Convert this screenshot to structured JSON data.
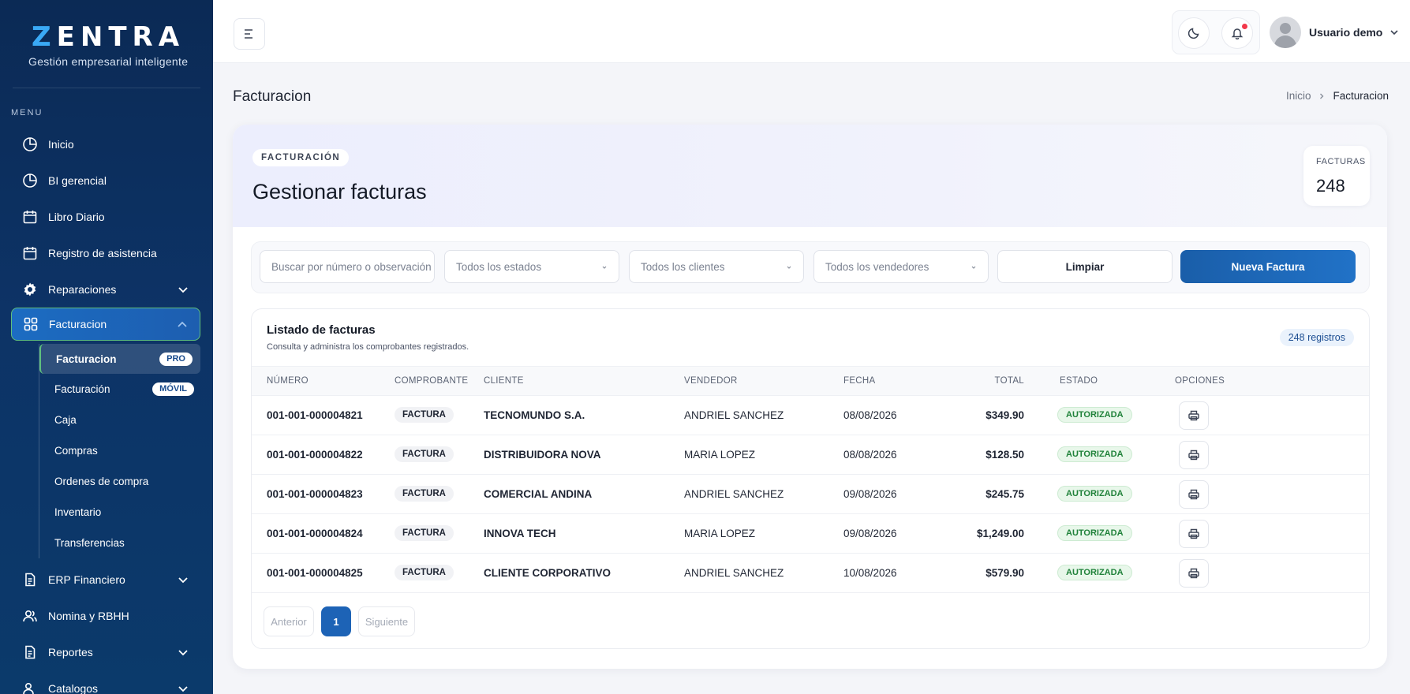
{
  "brand": {
    "logo_z": "Z",
    "logo_rest": "ENTRA",
    "tagline": "Gestión empresarial inteligente"
  },
  "sidebar": {
    "menu_title": "MENU",
    "items": [
      {
        "label": "Inicio",
        "icon": "pie-chart-icon"
      },
      {
        "label": "BI gerencial",
        "icon": "pie-chart-icon"
      },
      {
        "label": "Libro Diario",
        "icon": "calendar-icon"
      },
      {
        "label": "Registro de asistencia",
        "icon": "calendar-icon"
      },
      {
        "label": "Reparaciones",
        "icon": "gear-icon"
      },
      {
        "label": "Facturacion",
        "icon": "grid-icon"
      },
      {
        "label": "ERP Financiero",
        "icon": "document-icon"
      },
      {
        "label": "Nomina y RBHH",
        "icon": "users-icon"
      },
      {
        "label": "Reportes",
        "icon": "document-icon"
      },
      {
        "label": "Catalogos",
        "icon": "users-icon"
      }
    ],
    "submenu": [
      {
        "label": "Facturacion",
        "badge": "PRO"
      },
      {
        "label": "Facturación",
        "badge": "MÓVIL"
      },
      {
        "label": "Caja"
      },
      {
        "label": "Compras"
      },
      {
        "label": "Ordenes de compra"
      },
      {
        "label": "Inventario"
      },
      {
        "label": "Transferencias"
      }
    ]
  },
  "topbar": {
    "user_name": "Usuario demo"
  },
  "page": {
    "title": "Facturacion",
    "breadcrumb": {
      "home": "Inicio",
      "current": "Facturacion"
    }
  },
  "hero": {
    "tag": "FACTURACIÓN",
    "title": "Gestionar facturas",
    "stat_label": "FACTURAS",
    "stat_value": "248"
  },
  "filters": {
    "search_placeholder": "Buscar por número o observación",
    "estado": "Todos los estados",
    "cliente": "Todos los clientes",
    "vendedor": "Todos los vendedores",
    "clear_label": "Limpiar",
    "new_label": "Nueva Factura"
  },
  "list": {
    "title": "Listado de facturas",
    "subtitle": "Consulta y administra los comprobantes registrados.",
    "count": "248 registros",
    "columns": [
      "NÚMERO",
      "COMPROBANTE",
      "CLIENTE",
      "VENDEDOR",
      "FECHA",
      "TOTAL",
      "ESTADO",
      "OPCIONES"
    ],
    "rows": [
      {
        "numero": "001-001-000004821",
        "comprobante": "FACTURA",
        "cliente": "TECNOMUNDO S.A.",
        "vendedor": "ANDRIEL SANCHEZ",
        "fecha": "08/08/2026",
        "total": "$349.90",
        "estado": "AUTORIZADA"
      },
      {
        "numero": "001-001-000004822",
        "comprobante": "FACTURA",
        "cliente": "DISTRIBUIDORA NOVA",
        "vendedor": "MARIA LOPEZ",
        "fecha": "08/08/2026",
        "total": "$128.50",
        "estado": "AUTORIZADA"
      },
      {
        "numero": "001-001-000004823",
        "comprobante": "FACTURA",
        "cliente": "COMERCIAL ANDINA",
        "vendedor": "ANDRIEL SANCHEZ",
        "fecha": "09/08/2026",
        "total": "$245.75",
        "estado": "AUTORIZADA"
      },
      {
        "numero": "001-001-000004824",
        "comprobante": "FACTURA",
        "cliente": "INNOVA TECH",
        "vendedor": "MARIA LOPEZ",
        "fecha": "09/08/2026",
        "total": "$1,249.00",
        "estado": "AUTORIZADA"
      },
      {
        "numero": "001-001-000004825",
        "comprobante": "FACTURA",
        "cliente": "CLIENTE CORPORATIVO",
        "vendedor": "ANDRIEL SANCHEZ",
        "fecha": "10/08/2026",
        "total": "$579.90",
        "estado": "AUTORIZADA"
      }
    ]
  },
  "pager": {
    "prev": "Anterior",
    "page": "1",
    "next": "Siguiente"
  },
  "colors": {
    "accent": "#1d63b6",
    "sidebar": "#0d3366",
    "success": "#20823a",
    "notification": "#f2384a"
  }
}
